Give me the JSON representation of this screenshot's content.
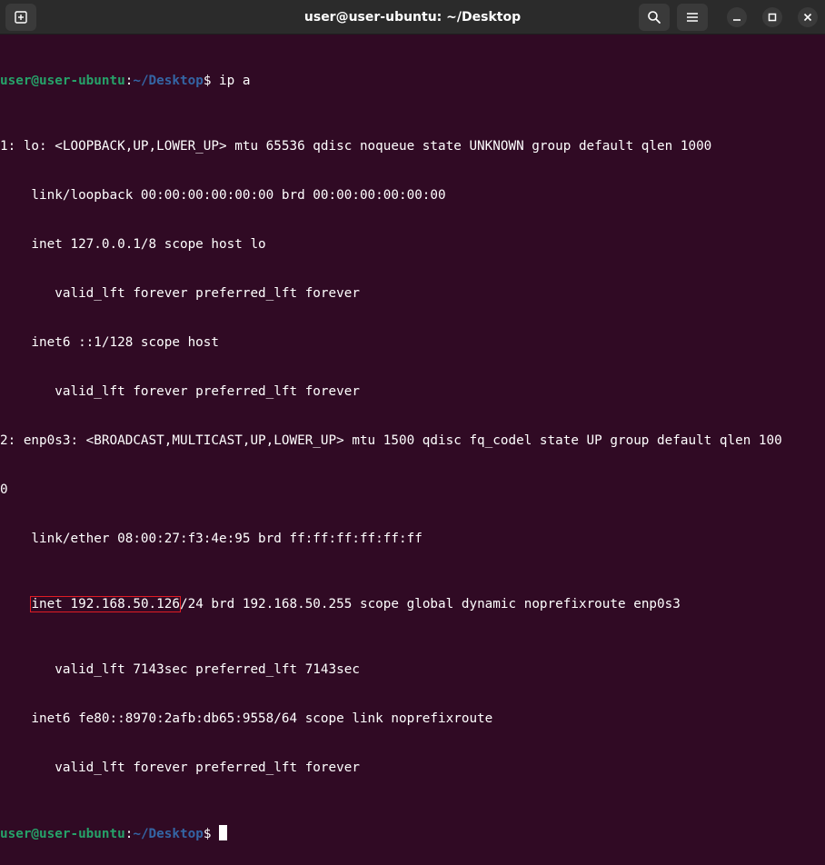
{
  "window": {
    "title": "user@user-ubuntu: ~/Desktop"
  },
  "icons": {
    "new_tab": "new-tab-icon",
    "search": "search-icon",
    "menu": "hamburger-menu-icon",
    "minimize": "minimize-icon",
    "maximize": "maximize-icon",
    "close": "close-icon"
  },
  "colors": {
    "background": "#300a24",
    "prompt_user": "#26a269",
    "prompt_path": "#3465a4",
    "highlight_box": "#e01b24"
  },
  "terminal": {
    "prompt1": {
      "user": "user@user-ubuntu",
      "sep": ":",
      "path": "~/Desktop",
      "symbol": "$",
      "command": " ip a"
    },
    "lines": [
      "1: lo: <LOOPBACK,UP,LOWER_UP> mtu 65536 qdisc noqueue state UNKNOWN group default qlen 1000",
      "    link/loopback 00:00:00:00:00:00 brd 00:00:00:00:00:00",
      "    inet 127.0.0.1/8 scope host lo",
      "       valid_lft forever preferred_lft forever",
      "    inet6 ::1/128 scope host",
      "       valid_lft forever preferred_lft forever",
      "2: enp0s3: <BROADCAST,MULTICAST,UP,LOWER_UP> mtu 1500 qdisc fq_codel state UP group default qlen 100",
      "0",
      "    link/ether 08:00:27:f3:4e:95 brd ff:ff:ff:ff:ff:ff"
    ],
    "highlight_line": {
      "indent": "    ",
      "highlighted": "inet 192.168.50.126",
      "rest": "/24 brd 192.168.50.255 scope global dynamic noprefixroute enp0s3"
    },
    "lines_after": [
      "       valid_lft 7143sec preferred_lft 7143sec",
      "    inet6 fe80::8970:2afb:db65:9558/64 scope link noprefixroute",
      "       valid_lft forever preferred_lft forever"
    ],
    "prompt2": {
      "user": "user@user-ubuntu",
      "sep": ":",
      "path": "~/Desktop",
      "symbol": "$ "
    }
  }
}
